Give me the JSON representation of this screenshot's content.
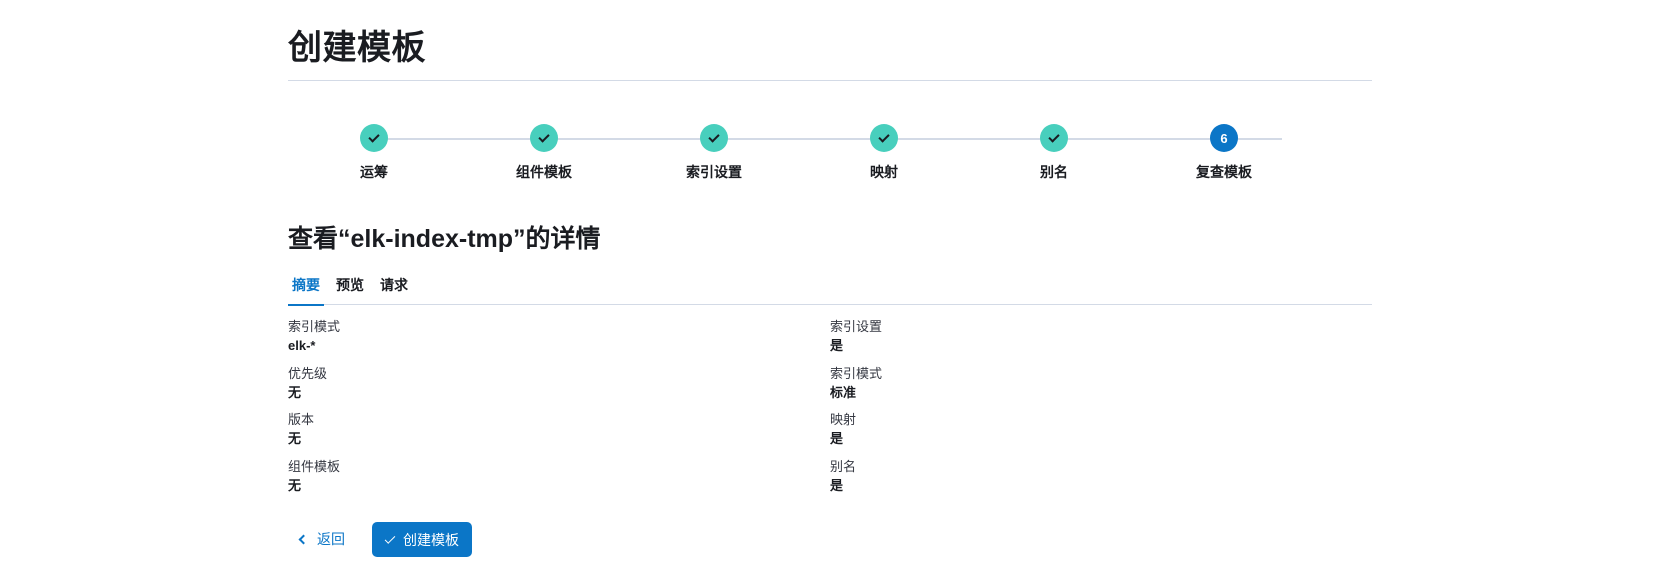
{
  "page": {
    "title": "创建模板"
  },
  "steps": [
    {
      "label": "运筹",
      "status": "complete",
      "icon": "check-icon"
    },
    {
      "label": "组件模板",
      "status": "complete",
      "icon": "check-icon"
    },
    {
      "label": "索引设置",
      "status": "complete",
      "icon": "check-icon"
    },
    {
      "label": "映射",
      "status": "complete",
      "icon": "check-icon"
    },
    {
      "label": "别名",
      "status": "complete",
      "icon": "check-icon"
    },
    {
      "label": "复查模板",
      "status": "current",
      "number": "6"
    }
  ],
  "review": {
    "title": "查看“elk-index-tmp”的详情",
    "tabs": [
      {
        "label": "摘要",
        "active": true
      },
      {
        "label": "预览",
        "active": false
      },
      {
        "label": "请求",
        "active": false
      }
    ],
    "left": [
      {
        "title": "索引模式",
        "value": "elk-*"
      },
      {
        "title": "优先级",
        "value": "无"
      },
      {
        "title": "版本",
        "value": "无"
      },
      {
        "title": "组件模板",
        "value": "无"
      }
    ],
    "right": [
      {
        "title": "索引设置",
        "value": "是"
      },
      {
        "title": "索引模式",
        "value": "标准"
      },
      {
        "title": "映射",
        "value": "是"
      },
      {
        "title": "别名",
        "value": "是"
      }
    ]
  },
  "actions": {
    "back_label": "返回",
    "create_label": "创建模板"
  },
  "colors": {
    "primary": "#0b76c7",
    "step_complete": "#48cfbd",
    "text": "#1a1c21",
    "border": "#d3dae6"
  }
}
